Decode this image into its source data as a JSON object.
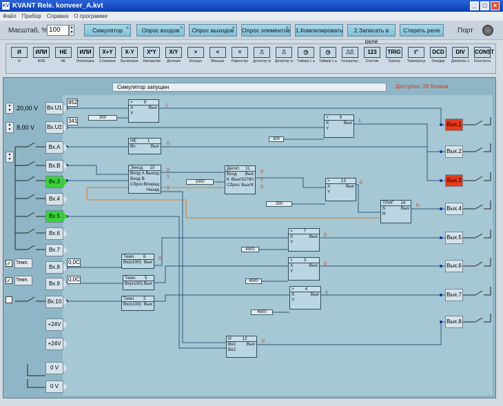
{
  "window": {
    "title": "KVANT Rele. konveer_A.kvt",
    "icon": "KV"
  },
  "menu": [
    "Файл",
    "Прибор",
    "Справка",
    "О программе"
  ],
  "toolbar": {
    "scale_label": "Масштаб, %",
    "scale_value": "100",
    "buttons": [
      "Симулятор",
      "Опрос входов",
      "Опрос выходов",
      "Опрос элементов",
      "1.Компилировать",
      "2.Записать в реле",
      "Стереть реле"
    ],
    "port_label": "Порт"
  },
  "palette": [
    {
      "icon": "И",
      "label": "И"
    },
    {
      "icon": "ИЛИ",
      "label": "ИЛИ"
    },
    {
      "icon": "НЕ",
      "label": "НЕ"
    },
    {
      "icon": "ИЛИ",
      "label": "Исключающее ИЛИ"
    },
    {
      "icon": "X+Y",
      "label": "Сложение"
    },
    {
      "icon": "X-Y",
      "label": "Вычитание"
    },
    {
      "icon": "X*Y",
      "label": "Умножение"
    },
    {
      "icon": "X/Y",
      "label": "Деление"
    },
    {
      "icon": ">",
      "label": "Больше"
    },
    {
      "icon": "<",
      "label": "Меньше"
    },
    {
      "icon": "=",
      "label": "Равенство"
    },
    {
      "icon": "⎍",
      "label": "Детектор переднего фронта"
    },
    {
      "icon": "⎍",
      "label": "Детектор заднего фронта"
    },
    {
      "icon": "◷",
      "label": "Таймер с задержкой включения"
    },
    {
      "icon": "◷",
      "label": "Таймер с задержкой выключения"
    },
    {
      "icon": "⎍⎍",
      "label": "Генератор импульсов"
    },
    {
      "icon": "123",
      "label": "Счетчик"
    },
    {
      "icon": "TRIG",
      "label": "Триггер"
    },
    {
      "icon": "t°",
      "label": "Температура"
    },
    {
      "icon": "DCD",
      "label": "Энкодер"
    },
    {
      "icon": "DIV",
      "label": "Делитель энкодера"
    },
    {
      "icon": "CONST",
      "label": "Константа"
    }
  ],
  "status": {
    "text": "Симулятор запущен",
    "available": "Доступно: 26 блоков"
  },
  "inputs": [
    {
      "label": "Вх.U1",
      "active": false
    },
    {
      "label": "Вх.U2",
      "active": false
    },
    {
      "label": "Вх.А",
      "active": false
    },
    {
      "label": "Вх.В",
      "active": false
    },
    {
      "label": "Вх.3",
      "active": true
    },
    {
      "label": "Вх.4",
      "active": false
    },
    {
      "label": "Вх.5",
      "active": true
    },
    {
      "label": "Вх.6",
      "active": false
    },
    {
      "label": "Вх.7",
      "active": false
    },
    {
      "label": "Вх.8",
      "active": false
    },
    {
      "label": "Вх.9",
      "active": false
    },
    {
      "label": "Вх.10",
      "active": false
    },
    {
      "label": "+24V",
      "active": false
    },
    {
      "label": "+24V",
      "active": false
    },
    {
      "label": "0 V",
      "active": false
    },
    {
      "label": "0 V",
      "active": false
    }
  ],
  "analog": {
    "u1_volt": "20,00 V",
    "u2_volt": "8,00 V",
    "u1_read": "852",
    "u2_read": "341"
  },
  "temps": [
    {
      "label": "Темп.",
      "checked": true,
      "value": "0,0С"
    },
    {
      "label": "Темп.",
      "checked": true,
      "value": "0,0С"
    },
    {
      "checked": false
    }
  ],
  "outputs": [
    {
      "label": "Вых.1",
      "active": true
    },
    {
      "label": "Вых.2",
      "active": false
    },
    {
      "label": "Вых.3",
      "active": true
    },
    {
      "label": "Вых.4",
      "active": false
    },
    {
      "label": "Вых.5",
      "active": false
    },
    {
      "label": "Вых.6",
      "active": false
    },
    {
      "label": "Вых.7",
      "active": false
    },
    {
      "label": "Вых.8",
      "active": false
    }
  ],
  "blocks": [
    {
      "head": ">",
      "num": "9",
      "rows": [
        "X",
        "Вых",
        "Y"
      ]
    },
    {
      "head": ">",
      "num": "9",
      "rows": [
        "X",
        "Вых",
        "Y"
      ]
    },
    {
      "head": "НЕ",
      "num": "1",
      "rows": [
        "Вх",
        "Вых"
      ]
    },
    {
      "head": "Энкод",
      "num": "10",
      "rows": [
        "Вход А",
        "Выход",
        "Вход В",
        "Вперед",
        "Сброс",
        "Назад"
      ]
    },
    {
      "head": "Делит.",
      "num": "11",
      "rows": [
        "Вход",
        "Вых",
        "К",
        "Вых/32760",
        "Сброс",
        "Вых/К"
      ]
    },
    {
      "head": ">",
      "num": "13",
      "rows": [
        "X",
        "Вых",
        "Y"
      ]
    },
    {
      "head": "ТРИГ",
      "num": "14",
      "rows": [
        "S",
        "Вых",
        "R"
      ]
    },
    {
      "head": ">",
      "num": "7",
      "rows": [
        "X",
        "Вых",
        "Y"
      ]
    },
    {
      "head": ">",
      "num": "3",
      "rows": [
        "X",
        "Вых",
        "Y"
      ]
    },
    {
      "head": ">",
      "num": "4",
      "rows": [
        "X",
        "Вых",
        "Y"
      ]
    },
    {
      "head": "Темп.",
      "num": "6",
      "rows": [
        "Вх(х100)",
        "Вых"
      ]
    },
    {
      "head": "Темп.",
      "num": "5",
      "rows": [
        "Вх(х100)",
        "Вых"
      ]
    },
    {
      "head": "Темп.",
      "num": "2",
      "rows": [
        "Вх(х100)",
        "Вых"
      ]
    },
    {
      "head": "И",
      "num": "12",
      "rows": [
        "Вх1",
        "Вых",
        "Вх2"
      ]
    }
  ],
  "constants": [
    "300",
    "300",
    "1000",
    "250",
    "4500",
    "4500",
    "4500"
  ],
  "signals": [
    "1",
    "1",
    "0",
    "0",
    "1",
    "1",
    "0",
    "1",
    "0",
    "0",
    "0",
    "0",
    "0",
    "0",
    "0",
    "0"
  ]
}
